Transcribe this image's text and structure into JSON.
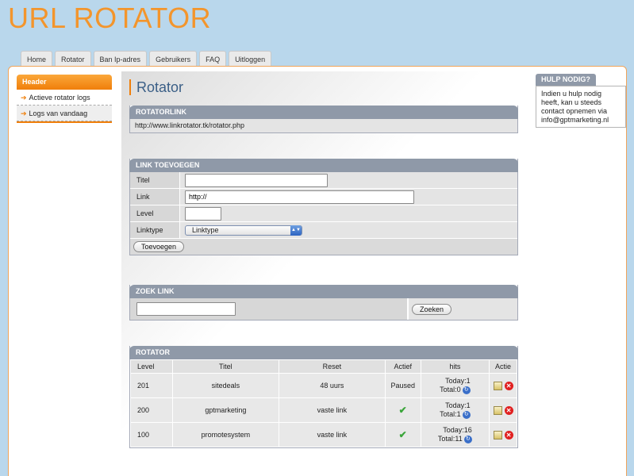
{
  "app": {
    "logo": "URL ROTATOR"
  },
  "nav": [
    "Home",
    "Rotator",
    "Ban Ip-adres",
    "Gebruikers",
    "FAQ",
    "Uitloggen"
  ],
  "sidebar": {
    "header": "Header",
    "items": [
      "Actieve rotator logs",
      "Logs van vandaag"
    ]
  },
  "page": {
    "title": "Rotator"
  },
  "rotatorlink": {
    "header": "ROTATORLINK",
    "url": "http://www.linkrotator.tk/rotator.php"
  },
  "add": {
    "header": "LINK TOEVOEGEN",
    "titel_label": "Titel",
    "link_label": "Link",
    "link_value": "http://",
    "level_label": "Level",
    "linktype_label": "Linktype",
    "linktype_selected": "Linktype",
    "submit": "Toevoegen"
  },
  "search": {
    "header": "ZOEK LINK",
    "button": "Zoeken"
  },
  "table": {
    "header": "ROTATOR",
    "columns": [
      "Level",
      "Titel",
      "Reset",
      "Actief",
      "hits",
      "Actie"
    ],
    "rows": [
      {
        "level": "201",
        "titel": "sitedeals",
        "reset": "48 uurs",
        "actief": "Paused",
        "today": "Today:1",
        "total": "Total:0"
      },
      {
        "level": "200",
        "titel": "gptmarketing",
        "reset": "vaste link",
        "actief": "✔",
        "today": "Today:1",
        "total": "Total:1"
      },
      {
        "level": "100",
        "titel": "promotesystem",
        "reset": "vaste link",
        "actief": "✔",
        "today": "Today:16",
        "total": "Total:11"
      }
    ]
  },
  "help": {
    "header": "HULP NODIG?",
    "text": "Indien u hulp nodig heeft, kan u steeds contact opnemen via info@gptmarketing.nl"
  },
  "icons": {
    "bullet": "arrow-right-icon",
    "reset": "refresh-icon",
    "edit": "edit-icon",
    "delete": "delete-icon",
    "active": "checkmark-icon"
  },
  "colors": {
    "accent": "#f07f0a",
    "background": "#b9d7ec",
    "box_header": "#8f99a8",
    "title": "#3b5f87"
  }
}
